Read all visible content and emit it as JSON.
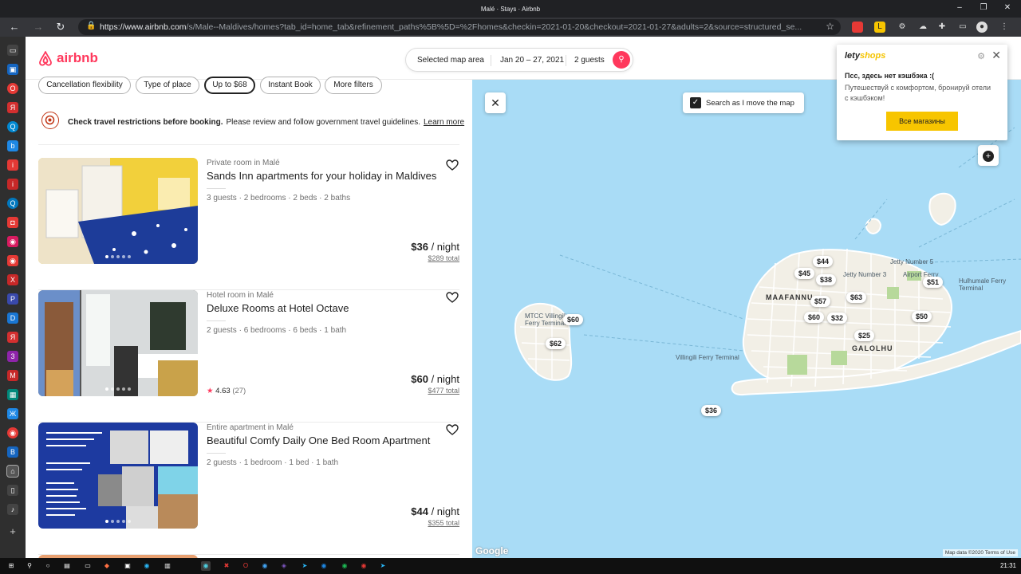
{
  "browser": {
    "window_title": "Malé · Stays · Airbnb",
    "url_host": "https://www.airbnb.com",
    "url_path": "/s/Male--Maldives/homes?tab_id=home_tab&refinement_paths%5B%5D=%2Fhomes&checkin=2021-01-20&checkout=2021-01-27&adults=2&source=structured_se..."
  },
  "header": {
    "logo": "airbnb",
    "search_area": "Selected map area",
    "dates": "Jan 20 – 27, 2021",
    "guests": "2 guests"
  },
  "filters": [
    "Cancellation flexibility",
    "Type of place",
    "Up to $68",
    "Instant Book",
    "More filters"
  ],
  "notice": {
    "bold": "Check travel restrictions before booking.",
    "text": "Please review and follow government travel guidelines.",
    "link": "Learn more"
  },
  "listings": [
    {
      "type": "Private room in Malé",
      "title": "Sands Inn apartments for your holiday in Maldives",
      "details": "3 guests · 2 bedrooms · 2 beds · 2 baths",
      "price": "$36",
      "per": " / night",
      "total": "$289 total"
    },
    {
      "type": "Hotel room in Malé",
      "title": "Deluxe Rooms at Hotel Octave",
      "details": "2 guests · 6 bedrooms · 6 beds · 1 bath",
      "rating": "4.63",
      "reviews": "(27)",
      "price": "$60",
      "per": " / night",
      "total": "$477 total"
    },
    {
      "type": "Entire apartment in Malé",
      "title": "Beautiful Comfy Daily One Bed Room Apartment",
      "details": "2 guests · 1 bedroom · 1 bed · 1 bath",
      "price": "$44",
      "per": " / night",
      "total": "$355 total"
    }
  ],
  "map": {
    "search_as_move": "Search as I move the map",
    "pins": [
      "$44",
      "$45",
      "$38",
      "$51",
      "$57",
      "$63",
      "$60",
      "$32",
      "$50",
      "$25",
      "$60",
      "$62",
      "$36"
    ],
    "labels": {
      "maafanni": "MAAFANNU",
      "galolhu": "GALOLHU",
      "jetty5": "Jetty Number 5",
      "jetty3": "Jetty Number 3",
      "hulhumale": "Hulhumale Ferry Terminal",
      "villingili": "Villingili Ferry Terminal",
      "mtcc": "MTCC Villingili Ferry Terminal",
      "airport": "Airport Ferry"
    },
    "google": "Google",
    "attribution": "Map data ©2020   Terms of Use"
  },
  "extension_popup": {
    "brand_a": "lety",
    "brand_b": "shops",
    "heading": "Псс, здесь нет кэшбэка :(",
    "body": "Путешествуй с комфортом, бронируй отели с кэшбэком!",
    "button": "Все магазины"
  },
  "taskbar": {
    "time": "21:31"
  },
  "colors": {
    "brand": "#ff385c",
    "map_water": "#a9dcf6",
    "popup_button": "#f7c500"
  }
}
